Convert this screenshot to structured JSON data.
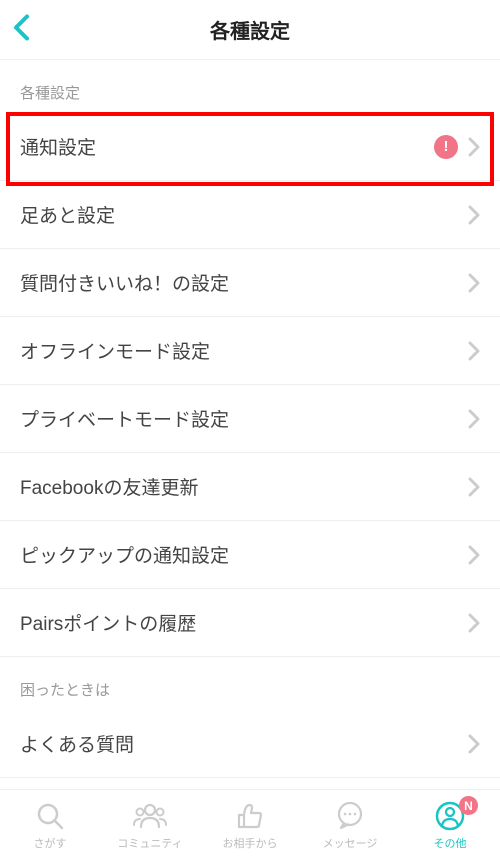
{
  "header": {
    "title": "各種設定"
  },
  "sections": {
    "settings": {
      "header": "各種設定",
      "items": [
        {
          "label": "通知設定",
          "alert": true
        },
        {
          "label": "足あと設定"
        },
        {
          "label": "質問付きいいね！の設定"
        },
        {
          "label": "オフラインモード設定"
        },
        {
          "label": "プライベートモード設定"
        },
        {
          "label": "Facebookの友達更新"
        },
        {
          "label": "ピックアップの通知設定"
        },
        {
          "label": "Pairsポイントの履歴"
        }
      ]
    },
    "help": {
      "header": "困ったときは",
      "items": [
        {
          "label": "よくある質問"
        }
      ]
    }
  },
  "alert_symbol": "!",
  "tabbar": {
    "items": [
      {
        "label": "さがす"
      },
      {
        "label": "コミュニティ"
      },
      {
        "label": "お相手から"
      },
      {
        "label": "メッセージ"
      },
      {
        "label": "その他",
        "active": true,
        "badge": "N"
      }
    ]
  }
}
